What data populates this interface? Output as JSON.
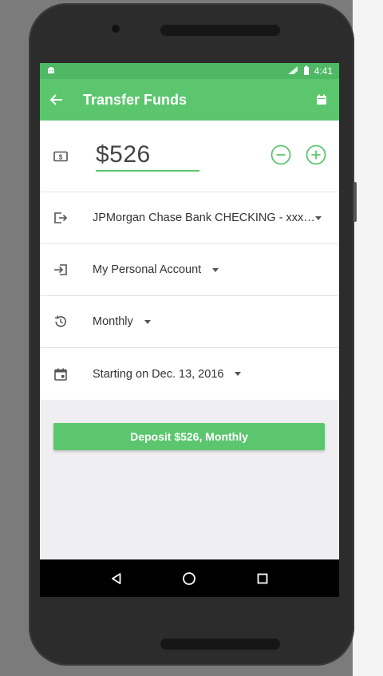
{
  "status_bar": {
    "time": "4:41",
    "icons": [
      "android-notification-icon",
      "signal-icon",
      "battery-icon"
    ]
  },
  "app_bar": {
    "title": "Transfer Funds",
    "back_icon": "arrow-back-icon",
    "calendar_icon": "calendar-icon"
  },
  "form": {
    "amount": "$526",
    "from_account": "JPMorgan Chase Bank CHECKING - xxx…",
    "to_account": "My Personal Account",
    "frequency": "Monthly",
    "start_date": "Starting on Dec. 13, 2016"
  },
  "deposit_button": {
    "label": "Deposit $526, Monthly"
  },
  "colors": {
    "status_bar": "#4fb864",
    "app_bar": "#5cc66f",
    "accent": "#5cc66f",
    "background": "#efeff2"
  },
  "nav_bar": {
    "icons": [
      "nav-back-icon",
      "nav-home-icon",
      "nav-recents-icon"
    ]
  }
}
